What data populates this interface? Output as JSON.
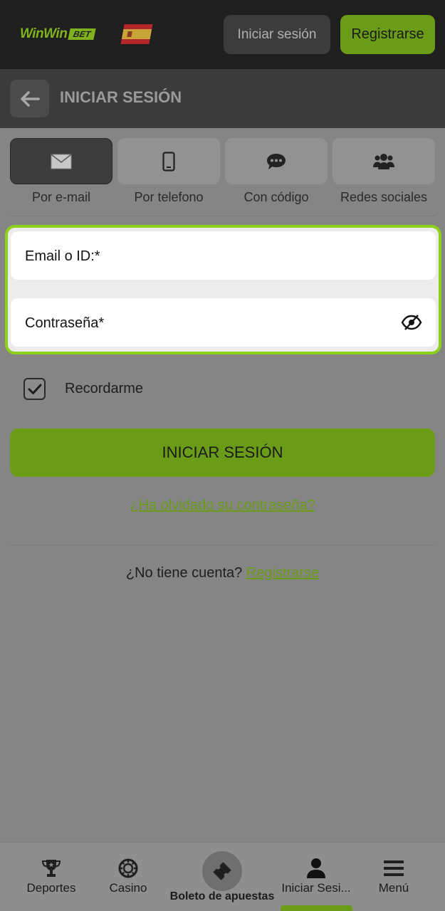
{
  "header": {
    "logo_text": "WinWin",
    "logo_badge": "BET",
    "language_flag": "flag-spain-icon",
    "login_label": "Iniciar sesión",
    "register_label": "Registrarse"
  },
  "title_bar": {
    "back_icon": "arrow-left-icon",
    "title": "INICIAR SESIÓN"
  },
  "login_methods": [
    {
      "label": "Por e-mail",
      "icon": "envelope-icon",
      "active": true
    },
    {
      "label": "Por telefono",
      "icon": "phone-icon",
      "active": false
    },
    {
      "label": "Con código",
      "icon": "chat-bubble-icon",
      "active": false
    },
    {
      "label": "Redes sociales",
      "icon": "users-icon",
      "active": false
    }
  ],
  "form": {
    "email_placeholder": "Email o ID:*",
    "password_placeholder": "Contraseña*",
    "password_toggle_icon": "eye-slash-icon",
    "remember_label": "Recordarme",
    "remember_checked": true,
    "submit_label": "INICIAR SESIÓN",
    "forgot_label": "¿Ha olvidado su contraseña?",
    "no_account_text": "¿No tiene cuenta?",
    "register_link": "Registrarse"
  },
  "bottom_nav": [
    {
      "label": "Deportes",
      "icon": "trophy-icon"
    },
    {
      "label": "Casino",
      "icon": "casino-chip-icon"
    },
    {
      "label": "Boleto de apuestas",
      "icon": "ticket-icon"
    },
    {
      "label": "Iniciar Sesi...",
      "icon": "user-icon",
      "active": true
    },
    {
      "label": "Menú",
      "icon": "hamburger-icon"
    }
  ],
  "colors": {
    "accent": "#6a9c17",
    "highlight": "#8ed11a",
    "header_bg": "#1f1f1f"
  }
}
